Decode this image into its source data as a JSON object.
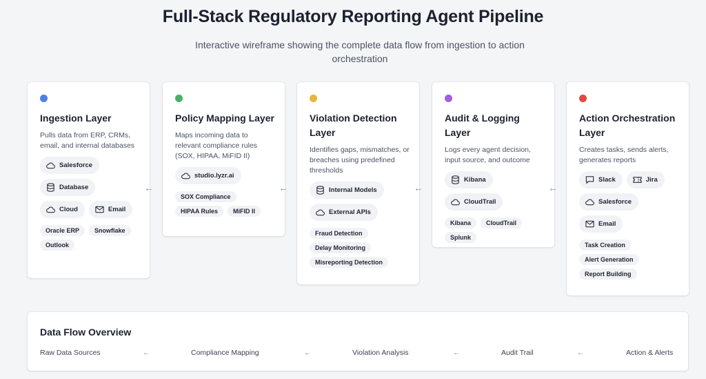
{
  "title": "Full-Stack Regulatory Reporting Agent Pipeline",
  "subtitle": "Interactive wireframe showing the complete data flow from ingestion to action orchestration",
  "arrow_glyph": "←",
  "layers": [
    {
      "name": "Ingestion Layer",
      "color": "#4f7fe8",
      "description": "Pulls data from ERP, CRMs, email, and internal databases",
      "pills": [
        [
          {
            "icon": "cloud-icon",
            "label": "Salesforce"
          }
        ],
        [
          {
            "icon": "database-icon",
            "label": "Database"
          }
        ],
        [
          {
            "icon": "cloud-icon",
            "label": "Cloud"
          },
          {
            "icon": "mail-icon",
            "label": "Email"
          }
        ]
      ],
      "tags": [
        "Oracle ERP",
        "Snowflake",
        "Outlook"
      ]
    },
    {
      "name": "Policy Mapping Layer",
      "color": "#4caf68",
      "description": "Maps incoming data to relevant compliance rules (SOX, HIPAA, MiFID II)",
      "pills": [
        [
          {
            "icon": "cloud-icon",
            "label": "studio.lyzr.ai"
          }
        ]
      ],
      "tags": [
        "SOX Compliance",
        "HIPAA Rules",
        "MiFID II"
      ]
    },
    {
      "name": "Violation Detection Layer",
      "color": "#e6b63e",
      "description": "Identifies gaps, mismatches, or breaches using predefined thresholds",
      "pills": [
        [
          {
            "icon": "database-icon",
            "label": "Internal Models"
          }
        ],
        [
          {
            "icon": "cloud-icon",
            "label": "External APIs"
          }
        ]
      ],
      "tags": [
        "Fraud Detection",
        "Delay Monitoring",
        "Misreporting Detection"
      ]
    },
    {
      "name": "Audit & Logging Layer",
      "color": "#a25fe0",
      "description": "Logs every agent decision, input source, and outcome",
      "pills": [
        [
          {
            "icon": "database-icon",
            "label": "Kibana"
          }
        ],
        [
          {
            "icon": "cloud-icon",
            "label": "CloudTrail"
          }
        ]
      ],
      "tags": [
        "Kibana",
        "CloudTrail",
        "Splunk"
      ]
    },
    {
      "name": "Action Orchestration Layer",
      "color": "#e0493f",
      "description": "Creates tasks, sends alerts, generates reports",
      "pills": [
        [
          {
            "icon": "chat-icon",
            "label": "Slack"
          },
          {
            "icon": "ticket-icon",
            "label": "Jira"
          }
        ],
        [
          {
            "icon": "cloud-icon",
            "label": "Salesforce"
          }
        ],
        [
          {
            "icon": "mail-icon",
            "label": "Email"
          }
        ]
      ],
      "tags": [
        "Task Creation",
        "Alert Generation",
        "Report Building"
      ]
    }
  ],
  "overview": {
    "title": "Data Flow Overview",
    "steps": [
      "Raw Data Sources",
      "Compliance Mapping",
      "Violation Analysis",
      "Audit Trail",
      "Action & Alerts"
    ]
  }
}
